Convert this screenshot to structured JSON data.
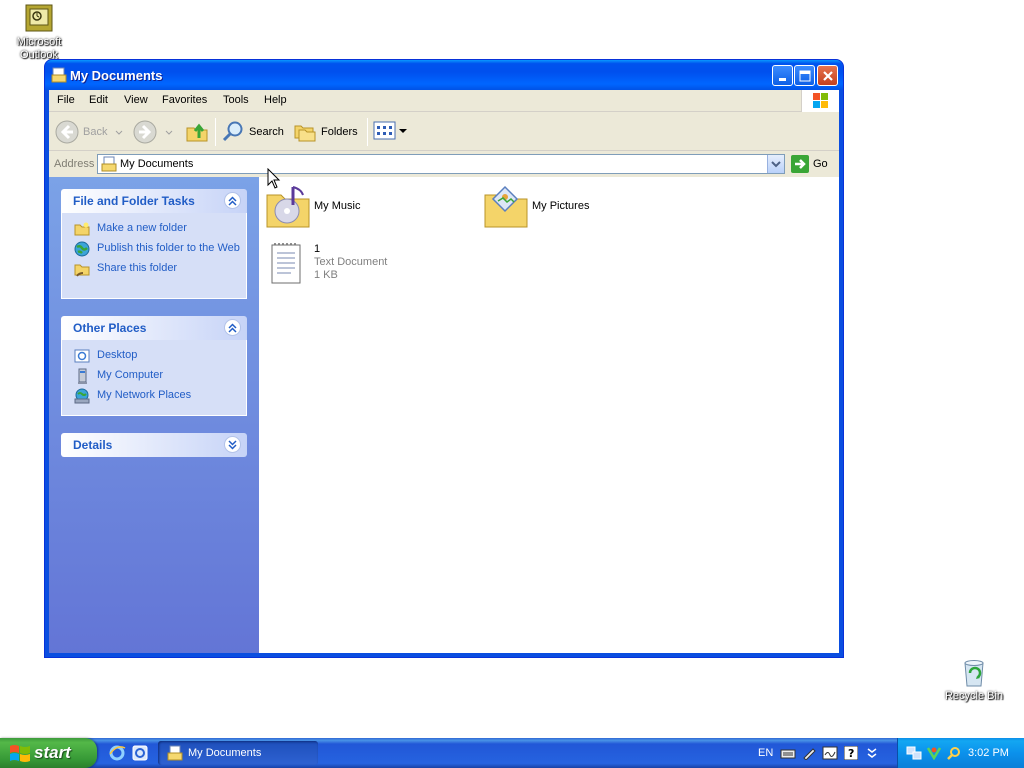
{
  "desktop": {
    "icons": [
      {
        "label": "Microsoft Outlook"
      },
      {
        "label": "Recycle Bin"
      }
    ]
  },
  "window": {
    "title": "My Documents",
    "menu": [
      "File",
      "Edit",
      "View",
      "Favorites",
      "Tools",
      "Help"
    ],
    "toolbar": {
      "back": "Back",
      "search": "Search",
      "folders": "Folders"
    },
    "address": {
      "label": "Address",
      "value": "My Documents",
      "go": "Go"
    },
    "sidebar": {
      "file_tasks": {
        "title": "File and Folder Tasks",
        "items": [
          "Make a new folder",
          "Publish this folder to the Web",
          "Share this folder"
        ]
      },
      "other_places": {
        "title": "Other Places",
        "items": [
          "Desktop",
          "My Computer",
          "My Network Places"
        ]
      },
      "details": {
        "title": "Details"
      }
    },
    "files": [
      {
        "name": "My Music",
        "icon": "music-folder-icon"
      },
      {
        "name": "My Pictures",
        "icon": "pictures-folder-icon"
      },
      {
        "name": "1",
        "type": "Text Document",
        "size": "1 KB",
        "icon": "text-document-icon"
      }
    ]
  },
  "taskbar": {
    "start": "start",
    "task_button": "My Documents",
    "language": "EN",
    "clock": "3:02 PM"
  },
  "colors": {
    "titlebar_blue": "#0054e3",
    "sidebar_blue": "#6375d6",
    "link_blue": "#215dc6",
    "start_green": "#3c9b3c"
  }
}
